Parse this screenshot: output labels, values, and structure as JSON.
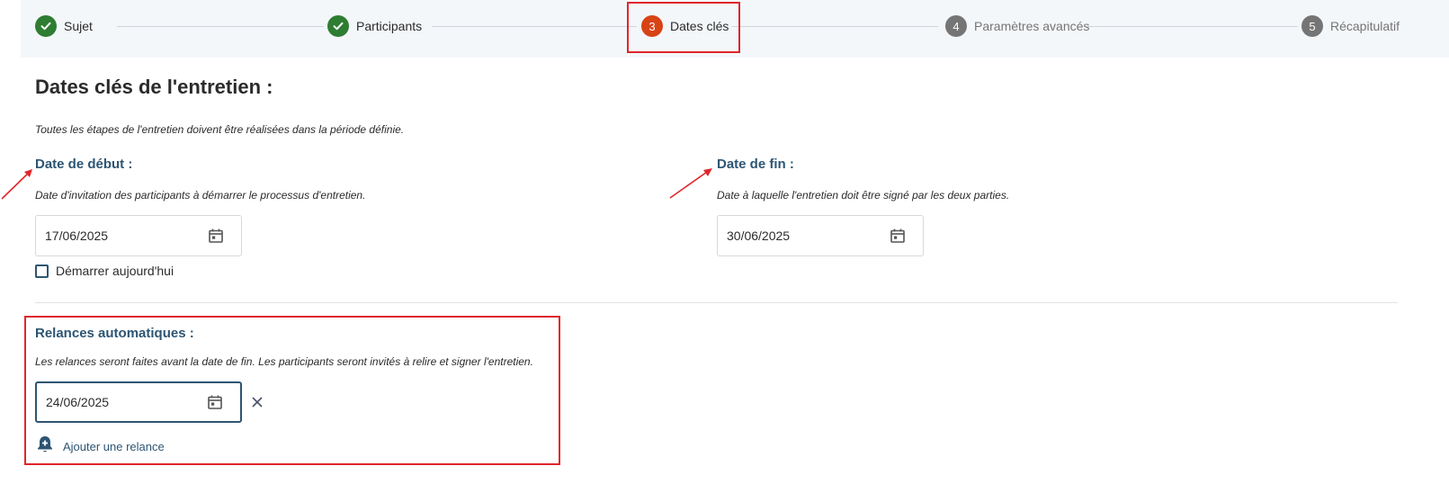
{
  "stepper": {
    "steps": [
      {
        "number": "✓",
        "label": "Sujet",
        "state": "done"
      },
      {
        "number": "✓",
        "label": "Participants",
        "state": "done"
      },
      {
        "number": "3",
        "label": "Dates clés",
        "state": "active"
      },
      {
        "number": "4",
        "label": "Paramètres avancés",
        "state": "todo"
      },
      {
        "number": "5",
        "label": "Récapitulatif",
        "state": "todo"
      }
    ]
  },
  "page": {
    "title": "Dates clés de l'entretien :",
    "intro": "Toutes les étapes de l'entretien doivent être réalisées dans la période définie."
  },
  "start": {
    "title": "Date de début :",
    "description": "Date d'invitation des participants à démarrer le processus d'entretien.",
    "value": "17/06/2025",
    "start_today_label": "Démarrer aujourd'hui"
  },
  "end": {
    "title": "Date de fin :",
    "description": "Date à laquelle l'entretien doit être signé par les deux parties.",
    "value": "30/06/2025"
  },
  "reminders": {
    "title": "Relances automatiques :",
    "description": "Les relances seront faites avant la date de fin. Les participants seront invités à relire et signer l'entretien.",
    "value": "24/06/2025",
    "add_label": "Ajouter une relance"
  },
  "colors": {
    "done": "#2e7d32",
    "active": "#d84315",
    "todo": "#757575",
    "section_title": "#2d5573",
    "highlight": "#e0262b"
  },
  "icons": {
    "check": "check-icon",
    "calendar": "calendar-icon",
    "clear": "close-icon",
    "add_reminder": "bell-plus-icon",
    "annotation": "red-arrow-icon"
  }
}
